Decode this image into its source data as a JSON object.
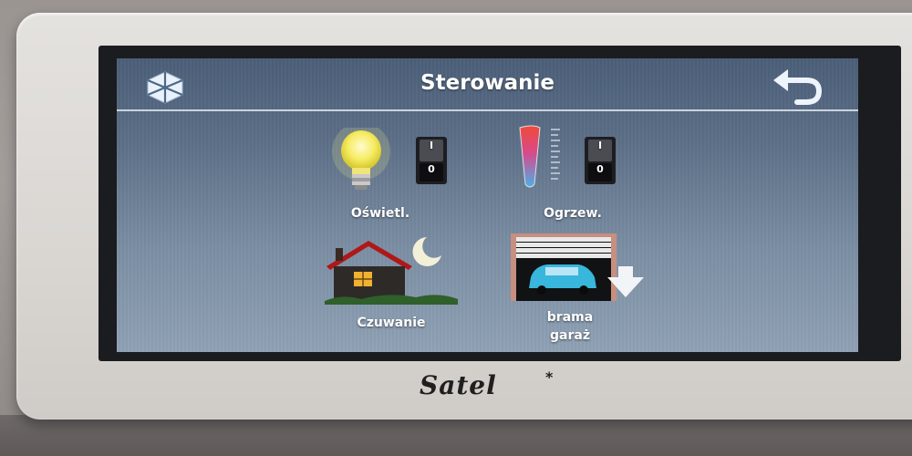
{
  "header": {
    "title": "Sterowanie"
  },
  "tiles": {
    "lighting": {
      "label": "Oświetl.",
      "switch_on": "I",
      "switch_off": "0"
    },
    "heating": {
      "label": "Ogrzew.",
      "switch_on": "I",
      "switch_off": "0"
    },
    "arming": {
      "label": "Czuwanie"
    },
    "garage": {
      "label_line1": "brama",
      "label_line2": "garaż"
    }
  },
  "brand": {
    "name": "Satel",
    "mark": "*"
  },
  "icons": {
    "menu": "snowflake-hex-icon",
    "back": "undo-arrow-icon",
    "lighting": "lightbulb-icon",
    "heating": "thermometer-icon",
    "arming": "house-night-icon",
    "garage": "garage-car-icon"
  },
  "colors": {
    "screen_top": "#4b5e78",
    "screen_bottom": "#8fa1b4",
    "accent_bulb": "#f6ec62"
  }
}
